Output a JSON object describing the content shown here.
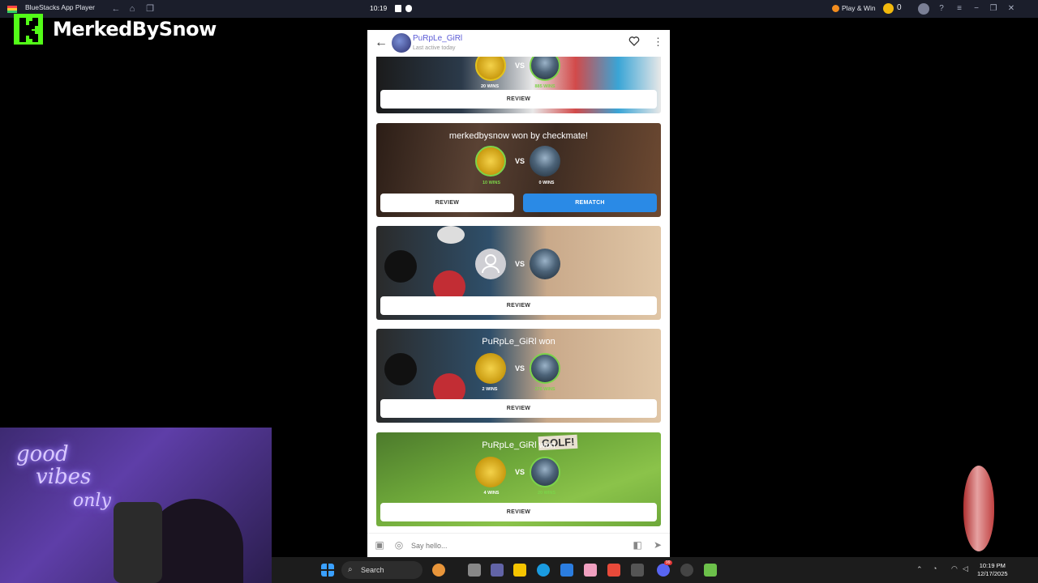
{
  "titlebar": {
    "app_name": "BlueStacks App Player",
    "time": "10:19",
    "play_win": "Play & Win",
    "coins": "0"
  },
  "brand": {
    "name": "MerkedBySnow"
  },
  "chat": {
    "username": "PuRpLe_GiRl",
    "last_active": "Last active today",
    "input_placeholder": "Say hello..."
  },
  "cards": [
    {
      "result": "",
      "left_wins": "20 WINS",
      "right_wins": "885 WINS",
      "vs": "VS",
      "review": "REVIEW"
    },
    {
      "result": "merkedbysnow won by checkmate!",
      "left_wins": "10 WINS",
      "right_wins": "0 WINS",
      "vs": "VS",
      "review": "REVIEW",
      "rematch": "REMATCH"
    },
    {
      "result": "",
      "vs": "VS",
      "review": "REVIEW"
    },
    {
      "result": "PuRpLe_GiRl won",
      "left_wins": "2 WINS",
      "right_wins": "276 WINS",
      "vs": "VS",
      "review": "REVIEW"
    },
    {
      "result": "PuRpLe_GiRl won",
      "left_wins": "4 WINS",
      "right_wins": "20 WINS",
      "vs": "VS",
      "review": "REVIEW",
      "sign": "GOLF!"
    }
  ],
  "webcam": {
    "neon_line1": "good",
    "neon_line2": "vibes",
    "neon_line3": "only"
  },
  "taskbar": {
    "search": "Search",
    "time": "10:19 PM",
    "date": "12/17/2025",
    "badge": "99"
  },
  "colors": {
    "accent_blue": "#2a8ae6",
    "kick_green": "#53fc18",
    "win_green": "#7cd44a"
  }
}
